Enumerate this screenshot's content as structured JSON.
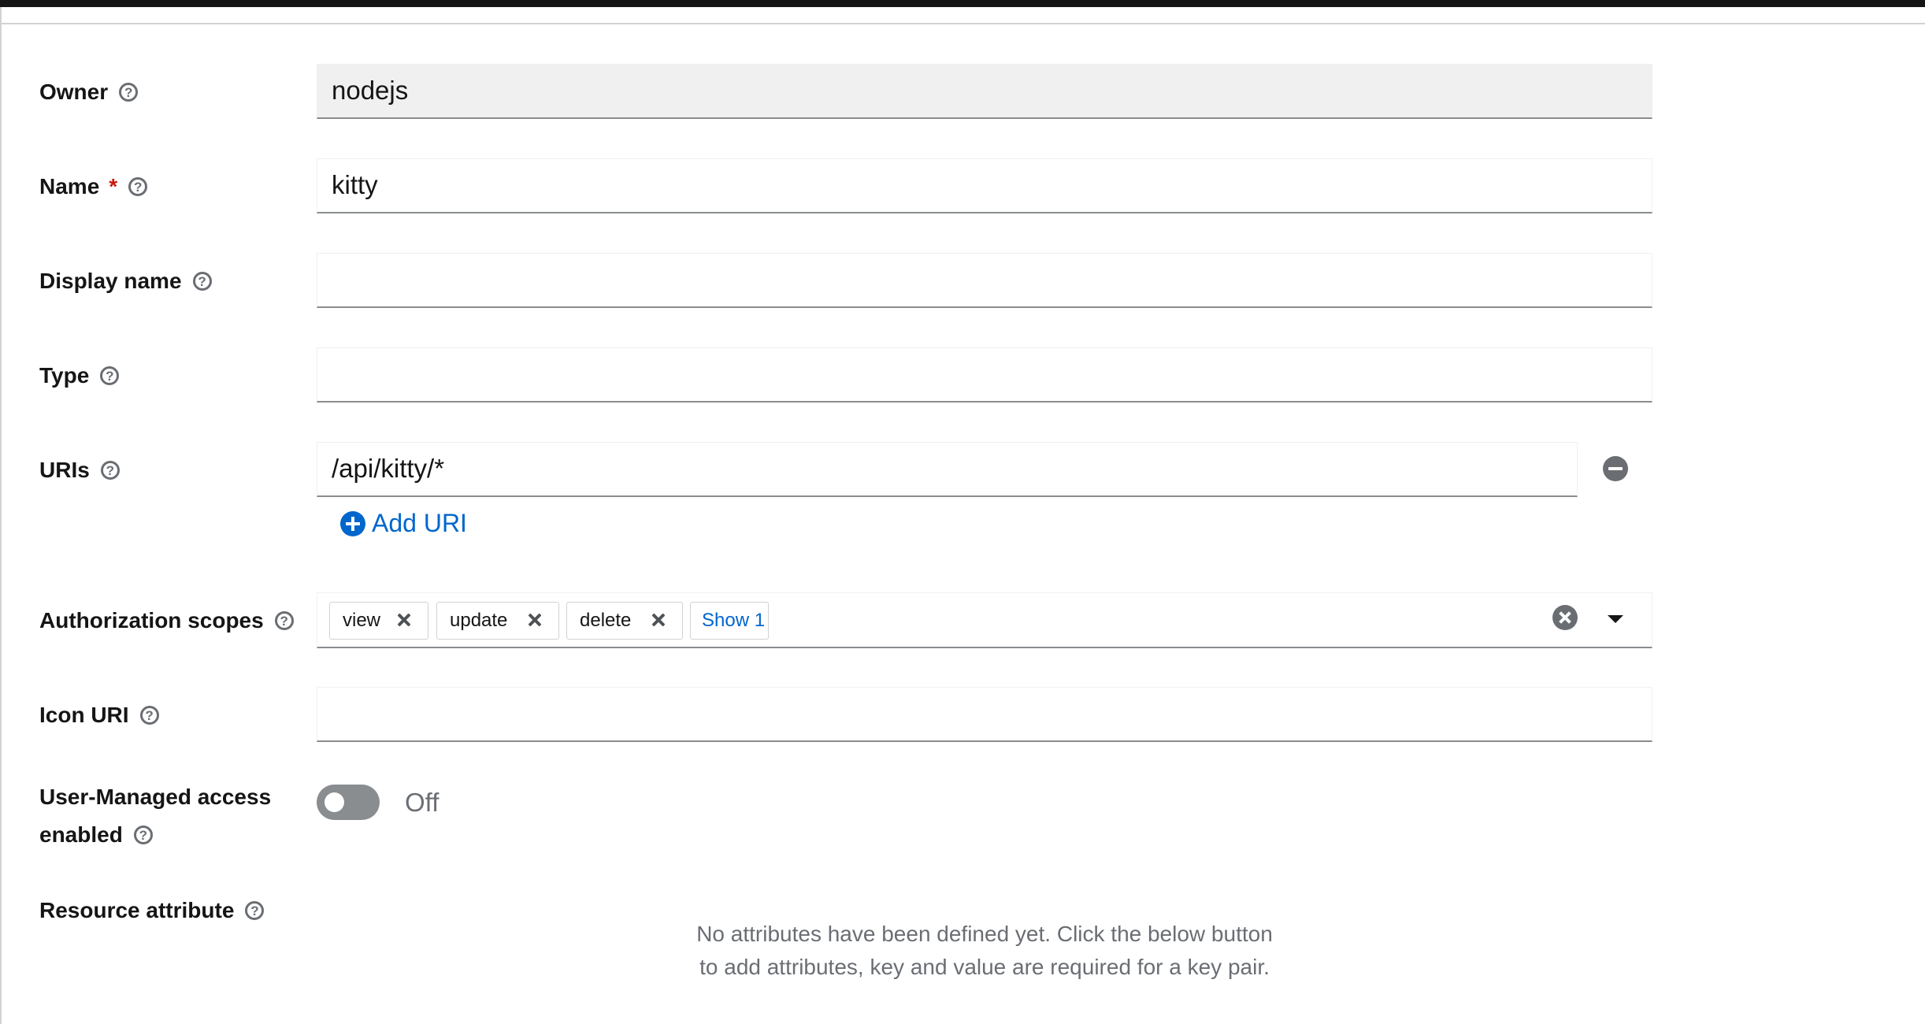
{
  "form": {
    "owner": {
      "label": "Owner",
      "value": "nodejs"
    },
    "name": {
      "label": "Name",
      "required_marker": "*",
      "value": "kitty"
    },
    "display_name": {
      "label": "Display name",
      "value": ""
    },
    "type": {
      "label": "Type",
      "value": ""
    },
    "uris": {
      "label": "URIs",
      "items": [
        "/api/kitty/*"
      ],
      "add_label": "Add URI"
    },
    "scopes": {
      "label": "Authorization scopes",
      "chips": [
        "view",
        "update",
        "delete"
      ],
      "more_label": "Show 1"
    },
    "icon_uri": {
      "label": "Icon URI",
      "value": ""
    },
    "user_managed": {
      "label_line1": "User-Managed access",
      "label_line2": "enabled",
      "state": "Off",
      "enabled": false
    },
    "resource_attribute": {
      "label": "Resource attribute",
      "empty_message": "No attributes have been defined yet. Click the below button to add attributes, key and value are required for a key pair."
    }
  },
  "icons": {
    "help": "question-circle-icon",
    "remove": "minus-circle-icon",
    "add": "plus-circle-icon",
    "clear": "times-circle-icon",
    "caret": "caret-down-icon"
  },
  "colors": {
    "link": "#0066cc",
    "required": "#c9190b",
    "toggle_off": "#8a8d90"
  }
}
